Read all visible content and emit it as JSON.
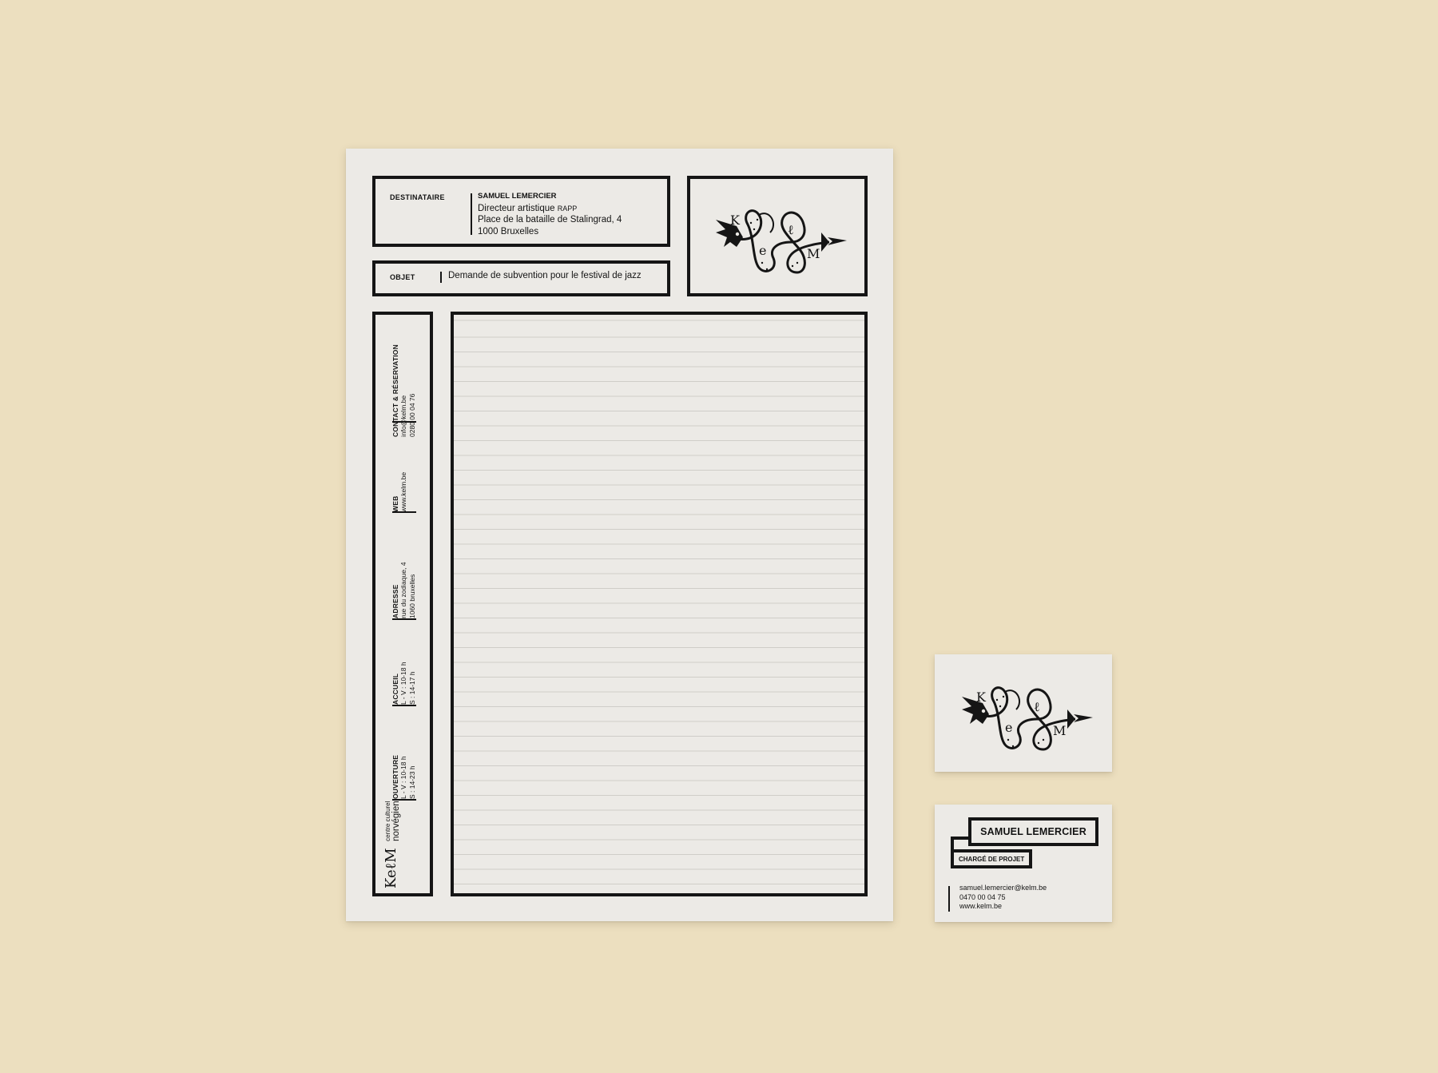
{
  "letterhead": {
    "destinataire_label": "DESTINATAIRE",
    "recipient": {
      "name": "SAMUEL LEMERCIER",
      "title": "Directeur artistique",
      "organization": "RAPP",
      "street": "Place de la bataille de Stalingrad, 4",
      "city": "1000 Bruxelles"
    },
    "objet_label": "OBJET",
    "subject": "Demande de subvention pour le festival de jazz",
    "sidebar": {
      "contact_label": "CONTACT & RÉSERVATION",
      "contact_lines": [
        "info@kelm.be",
        "0280 00 04 76"
      ],
      "web_label": "WEB",
      "web_lines": [
        "www.kelm.be"
      ],
      "address_label": "ADRESSE",
      "address_lines": [
        "rue du zodiaque, 4",
        "1060 bruxelles"
      ],
      "accueil_label": "ACCUEIL",
      "accueil_lines": [
        "L - V : 10-18 h",
        "S : 14-17 h"
      ],
      "ouverture_label": "OUVERTURE",
      "ouverture_lines": [
        "L - V : 10-18 h",
        "S : 14-23 h"
      ],
      "brand_mark": "KeℓM",
      "brand_tagline_1": "centre culturel",
      "brand_tagline_2": "norvégien"
    },
    "logo_letters": [
      "K",
      "e",
      "ℓ",
      "M"
    ]
  },
  "business_card_front": {
    "logo_letters": [
      "K",
      "e",
      "ℓ",
      "M"
    ]
  },
  "business_card_back": {
    "name": "SAMUEL LEMERCIER",
    "role": "CHARGÉ DE PROJET",
    "email": "samuel.lemercier@kelm.be",
    "phone": "0470 00 04 75",
    "web": "www.kelm.be"
  },
  "colors": {
    "background": "#ecdfbf",
    "paper": "#eceae6",
    "ink": "#151515"
  }
}
